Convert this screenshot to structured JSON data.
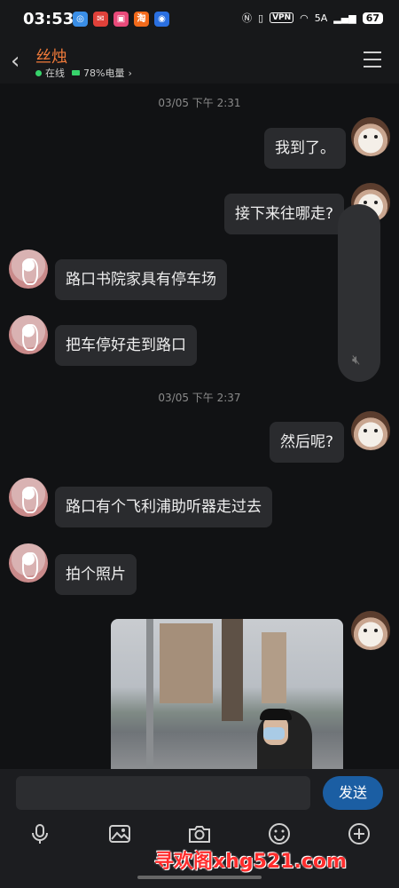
{
  "status_bar": {
    "time": "03:53",
    "vpn": "VPN",
    "network": "5A",
    "battery": "67"
  },
  "header": {
    "contact_name": "丝烛",
    "online": "在线",
    "battery_text": "78%电量"
  },
  "timestamps": [
    "03/05 下午 2:31",
    "03/05 下午 2:37"
  ],
  "messages": [
    {
      "from": "me",
      "text": "我到了。"
    },
    {
      "from": "me",
      "text": "接下来往哪走?"
    },
    {
      "from": "them",
      "text": "路口书院家具有停车场"
    },
    {
      "from": "them",
      "text": "把车停好走到路口"
    },
    {
      "from": "me",
      "text": "然后呢?"
    },
    {
      "from": "them",
      "text": "路口有个飞利浦助听器走过去"
    },
    {
      "from": "them",
      "text": "拍个照片"
    },
    {
      "from": "me",
      "type": "image"
    }
  ],
  "composer": {
    "send_label": "发送",
    "placeholder": ""
  },
  "toolbar_icons": [
    "microphone-icon",
    "image-icon",
    "camera-icon",
    "emoji-icon",
    "plus-icon"
  ],
  "watermark": "寻欢阁xhg521.com",
  "colors": {
    "accent": "#f07a3a",
    "send": "#1b5ea3",
    "online": "#37d36b"
  }
}
